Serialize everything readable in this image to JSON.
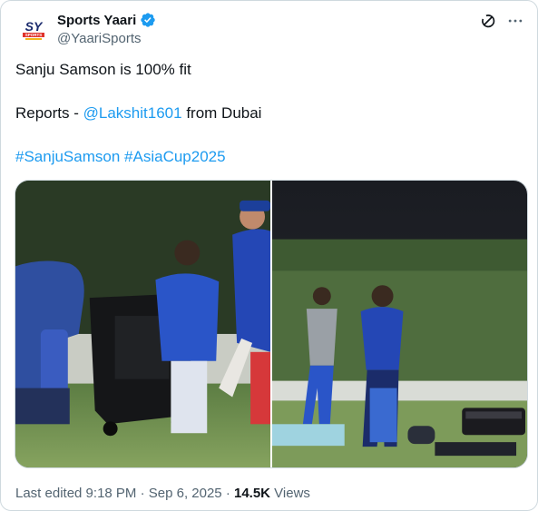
{
  "author": {
    "display_name": "Sports Yaari",
    "handle": "@YaariSports",
    "verified": true,
    "avatar_text": "SY",
    "avatar_subtext": "SPORTS"
  },
  "header_icons": [
    "grok-icon",
    "more-icon"
  ],
  "tweet": {
    "line1": "Sanju Samson is 100% fit",
    "line2_prefix": "Reports - ",
    "line2_mention": "@Lakshit1601",
    "line2_suffix": " from Dubai",
    "hashtag1": "#SanjuSamson",
    "hashtag_sep": " ",
    "hashtag2": "#AsiaCup2025"
  },
  "footer": {
    "edited": "Last edited 9:18 PM · Sep 6, 2025 · ",
    "views_count": "14.5K",
    "views_label": " Views"
  },
  "colors": {
    "link": "#1d9bf0",
    "secondary_text": "#536471",
    "border": "#cfd9de",
    "verified": "#1d9bf0",
    "avatar_red": "#e0322b",
    "avatar_gold": "#f2b51c"
  }
}
